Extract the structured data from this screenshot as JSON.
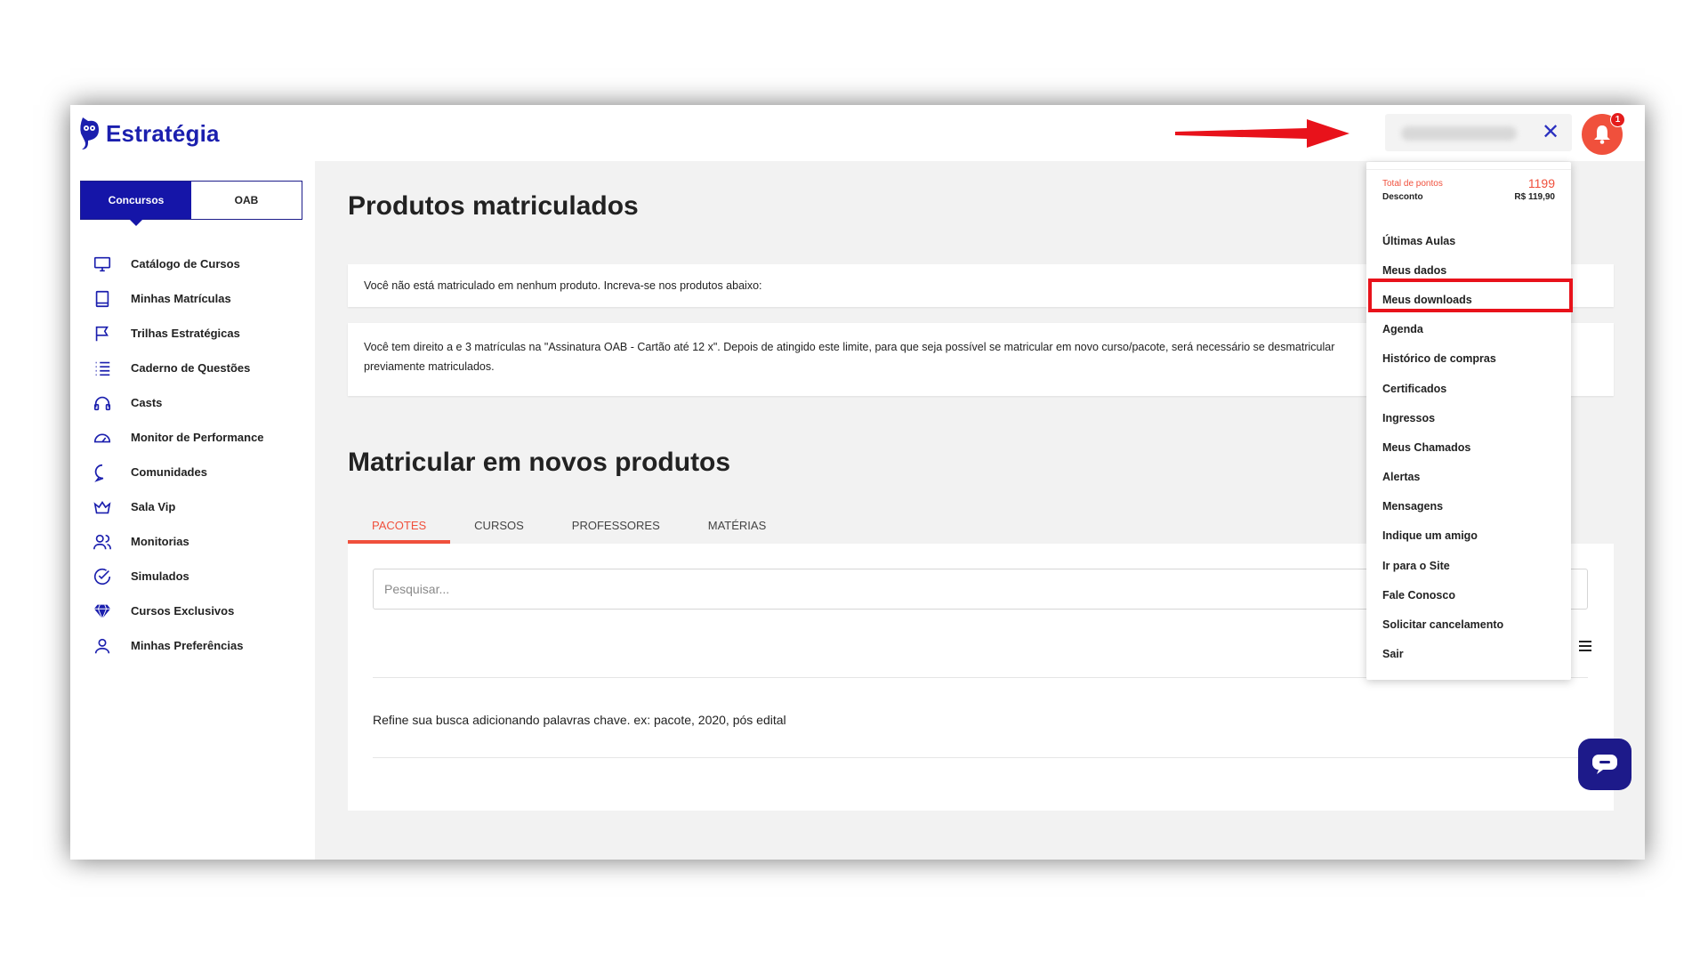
{
  "header": {
    "brand": "Estratégia",
    "notification_count": "1"
  },
  "sidebar": {
    "segments": [
      {
        "label": "Concursos",
        "active": true
      },
      {
        "label": "OAB",
        "active": false
      }
    ],
    "items": [
      {
        "label": "Catálogo de Cursos",
        "icon": "monitor-icon"
      },
      {
        "label": "Minhas Matrículas",
        "icon": "book-icon"
      },
      {
        "label": "Trilhas Estratégicas",
        "icon": "flag-icon"
      },
      {
        "label": "Caderno de Questões",
        "icon": "list-icon"
      },
      {
        "label": "Casts",
        "icon": "headphones-icon"
      },
      {
        "label": "Monitor de Performance",
        "icon": "gauge-icon"
      },
      {
        "label": "Comunidades",
        "icon": "chat-bubble-icon"
      },
      {
        "label": "Sala Vip",
        "icon": "crown-icon"
      },
      {
        "label": "Monitorias",
        "icon": "users-icon"
      },
      {
        "label": "Simulados",
        "icon": "check-circle-icon"
      },
      {
        "label": "Cursos Exclusivos",
        "icon": "diamond-icon"
      },
      {
        "label": "Minhas Preferências",
        "icon": "user-icon"
      }
    ]
  },
  "main": {
    "enrolled_title": "Produtos matriculados",
    "enrolled_empty": "Você não está matriculado em nenhum produto. Increva-se nos produtos abaixo:",
    "enrolled_notice_line1": "Você tem direito a e 3 matrículas na \"Assinatura OAB - Cartão até 12 x\". Depois de atingido este limite, para que seja possível se matricular em novo curso/pacote, será necessário se desmatricular",
    "enrolled_notice_line2": "previamente matriculados.",
    "new_title": "Matricular em novos produtos",
    "tabs": [
      {
        "label": "PACOTES",
        "active": true
      },
      {
        "label": "CURSOS",
        "active": false
      },
      {
        "label": "PROFESSORES",
        "active": false
      },
      {
        "label": "MATÉRIAS",
        "active": false
      }
    ],
    "search_placeholder": "Pesquisar...",
    "hint": "Refine sua busca adicionando palavras chave. ex: pacote, 2020, pós edital"
  },
  "dropdown": {
    "points_label": "Total de pontos",
    "points_value": "1199",
    "discount_label": "Desconto",
    "discount_value": "R$ 119,90",
    "items": [
      "Últimas Aulas",
      "Meus dados",
      "Meus downloads",
      "Agenda",
      "Histórico de compras",
      "Certificados",
      "Ingressos",
      "Meus Chamados",
      "Alertas",
      "Mensagens",
      "Indique um amigo",
      "Ir para o Site",
      "Fale Conosco",
      "Solicitar cancelamento",
      "Sair"
    ],
    "highlighted_item": "Meus downloads"
  },
  "colors": {
    "brand_blue": "#1b1fae",
    "accent_coral": "#f0503c",
    "highlight_red": "#e8121b",
    "arrow_red": "#e8121b"
  }
}
